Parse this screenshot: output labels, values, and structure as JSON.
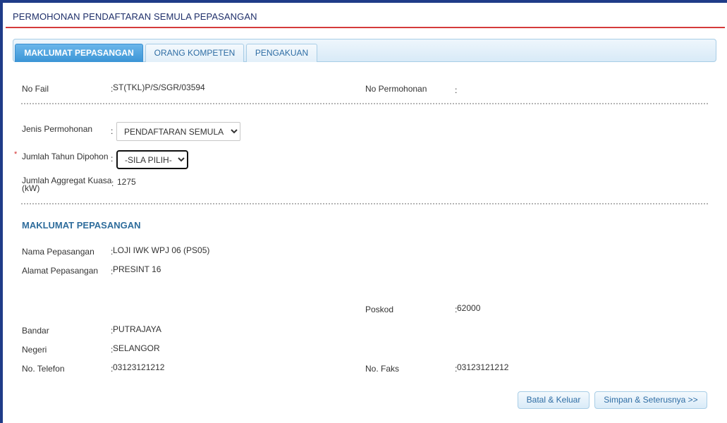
{
  "page": {
    "title": "PERMOHONAN PENDAFTARAN SEMULA PEPASANGAN"
  },
  "tabs": [
    {
      "label": "MAKLUMAT PEPASANGAN",
      "active": true
    },
    {
      "label": "ORANG KOMPETEN",
      "active": false
    },
    {
      "label": "PENGAKUAN",
      "active": false
    }
  ],
  "header_info": {
    "no_fail_label": "No Fail",
    "no_fail_value": "ST(TKL)P/S/SGR/03594",
    "no_permohonan_label": "No Permohonan",
    "no_permohonan_value": ""
  },
  "form": {
    "jenis_label": "Jenis Permohonan",
    "jenis_value": "PENDAFTARAN SEMULA",
    "jumlah_tahun_label": "Jumlah Tahun Dipohon",
    "jumlah_tahun_required_mark": "*",
    "jumlah_tahun_value": "-SILA PILIH-",
    "aggregat_label_line1": "Jumlah Aggregat Kuasa",
    "aggregat_label_line2": "(kW)",
    "aggregat_value": "1275"
  },
  "section": {
    "title": "MAKLUMAT PEPASANGAN",
    "nama_label": "Nama Pepasangan",
    "nama_value": "LOJI IWK WPJ 06 (PS05)",
    "alamat_label": "Alamat Pepasangan",
    "alamat_value": "PRESINT 16",
    "poskod_label": "Poskod",
    "poskod_value": "62000",
    "bandar_label": "Bandar",
    "bandar_value": "PUTRAJAYA",
    "negeri_label": "Negeri",
    "negeri_value": "SELANGOR",
    "telefon_label": "No. Telefon",
    "telefon_value": "03123121212",
    "faks_label": "No. Faks",
    "faks_value": "03123121212"
  },
  "buttons": {
    "cancel_label": "Batal & Keluar",
    "save_label": "Simpan & Seterusnya >>"
  },
  "colors": {
    "frame": "#1f3c88",
    "title_rule": "#d53b3b",
    "tab_active": "#3b95d6",
    "section_title": "#2f6d9c",
    "link_text": "#2e6da4"
  }
}
